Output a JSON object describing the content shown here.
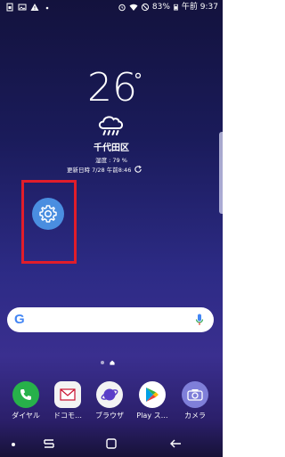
{
  "status_bar": {
    "battery": "83%",
    "time": "午前 9:37",
    "left_icons": [
      "sim-icon",
      "image-icon",
      "warning-icon",
      "dot-icon"
    ],
    "right_icons": [
      "alarm-icon",
      "wifi-icon",
      "do-not-disturb-icon",
      "battery-icon"
    ]
  },
  "weather": {
    "temperature": "26",
    "unit": "°",
    "icon": "rain-cloud-icon",
    "location": "千代田区",
    "humidity": "湿度 : 79 %",
    "updated": "更新日時 7/28 午前8:46"
  },
  "desktop": {
    "settings_icon": "settings-gear-icon",
    "highlight_color": "#e11d2a"
  },
  "search": {
    "logo": "G",
    "icon": "mic-icon"
  },
  "dock": {
    "apps": [
      {
        "label": "ダイヤル",
        "icon": "phone-icon",
        "color": "#27b14a"
      },
      {
        "label": "ドコモ…",
        "icon": "docomo-mail-icon",
        "color": "#f3f3f3"
      },
      {
        "label": "ブラウザ",
        "icon": "samsung-internet-icon",
        "color": "#f3f3f3"
      },
      {
        "label": "Play ス…",
        "icon": "play-store-icon",
        "color": "#ffffff"
      },
      {
        "label": "カメラ",
        "icon": "camera-icon",
        "color": "#7f7fd9"
      }
    ]
  },
  "navbar": {
    "icons": [
      "dot-icon",
      "recent-apps-icon",
      "home-icon",
      "back-icon"
    ]
  }
}
